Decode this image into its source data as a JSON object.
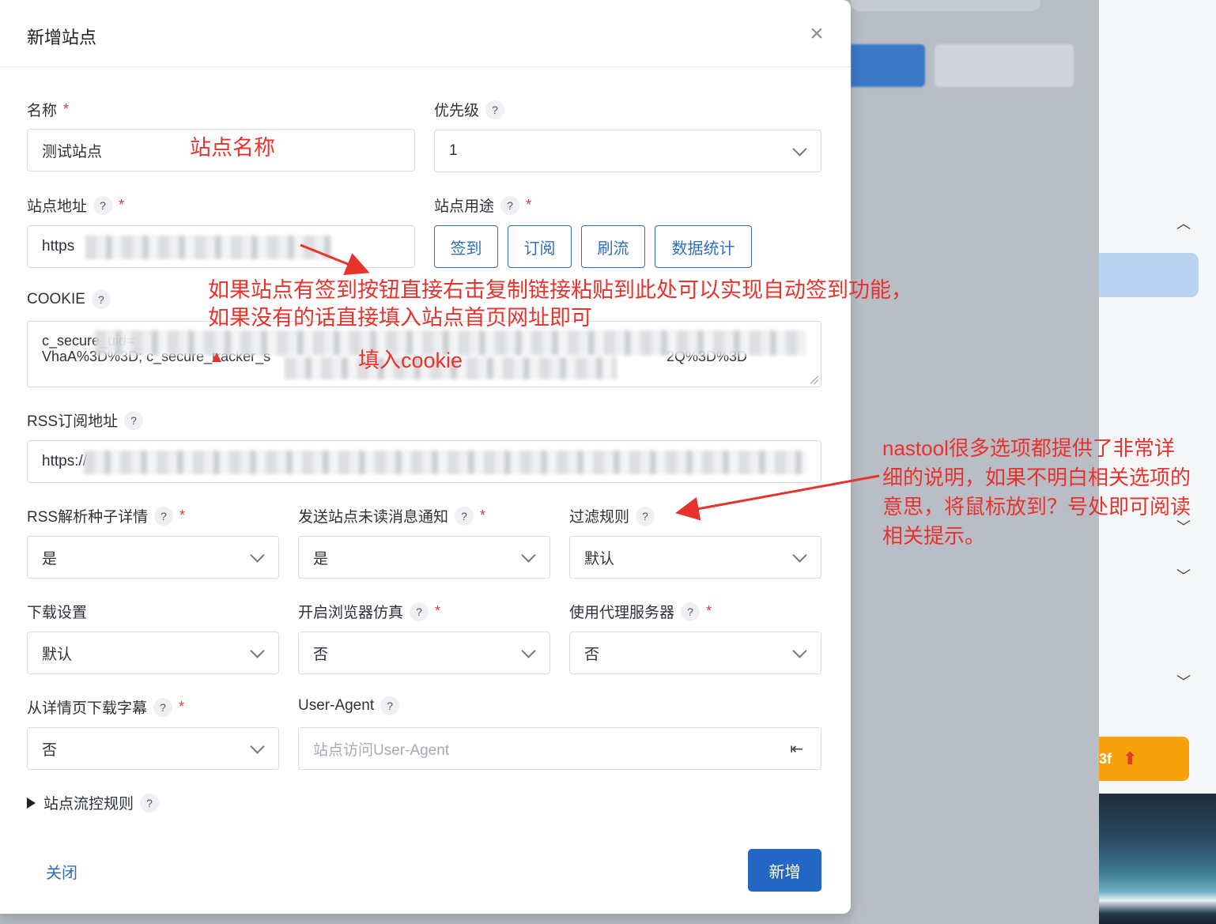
{
  "modal": {
    "title": "新增站点",
    "close_icon": "×"
  },
  "fields": {
    "name": {
      "label": "名称",
      "value": "测试站点"
    },
    "priority": {
      "label": "优先级",
      "value": "1"
    },
    "site_url": {
      "label": "站点地址",
      "value": "https"
    },
    "site_use": {
      "label": "站点用途",
      "options": [
        "签到",
        "订阅",
        "刷流",
        "数据统计"
      ]
    },
    "cookie": {
      "label": "COOKIE",
      "line1": "c_secure_uid=",
      "line2": "VhaA%3D%3D; c_secure_tracker_s",
      "line2_end": "2Q%3D%3D"
    },
    "rss": {
      "label": "RSS订阅地址",
      "value": "https://"
    },
    "rss_parse": {
      "label": "RSS解析种子详情",
      "value": "是"
    },
    "notify": {
      "label": "发送站点未读消息通知",
      "value": "是"
    },
    "filter_rule": {
      "label": "过滤规则",
      "value": "默认"
    },
    "download": {
      "label": "下载设置",
      "value": "默认"
    },
    "browser": {
      "label": "开启浏览器仿真",
      "value": "否"
    },
    "proxy": {
      "label": "使用代理服务器",
      "value": "否"
    },
    "subtitle": {
      "label": "从详情页下载字幕",
      "value": "否"
    },
    "user_agent": {
      "label": "User-Agent",
      "placeholder": "站点访问User-Agent"
    }
  },
  "section": {
    "label": "站点流控规则"
  },
  "footer": {
    "close_label": "关闭",
    "add_label": "新增"
  },
  "help_mark": "?",
  "required_mark": "*",
  "annotations": {
    "name": "站点名称",
    "url_line1": "如果站点有签到按钮直接右击复制链接粘贴到此处可以实现自动签到功能，",
    "url_line2": "如果没有的话直接填入站点首页网址即可",
    "cookie": "填入cookie",
    "help_line1": "nastool很多选项都提供了非常详",
    "help_line2": "细的说明，如果不明白相关选项的",
    "help_line3": "意思，将鼠标放到？号处即可阅读",
    "help_line4": "相关提示。"
  },
  "background": {
    "badge_text": "3f"
  },
  "colors": {
    "primary": "#2367c5",
    "annotation": "#e8322c",
    "required": "#d63939"
  }
}
